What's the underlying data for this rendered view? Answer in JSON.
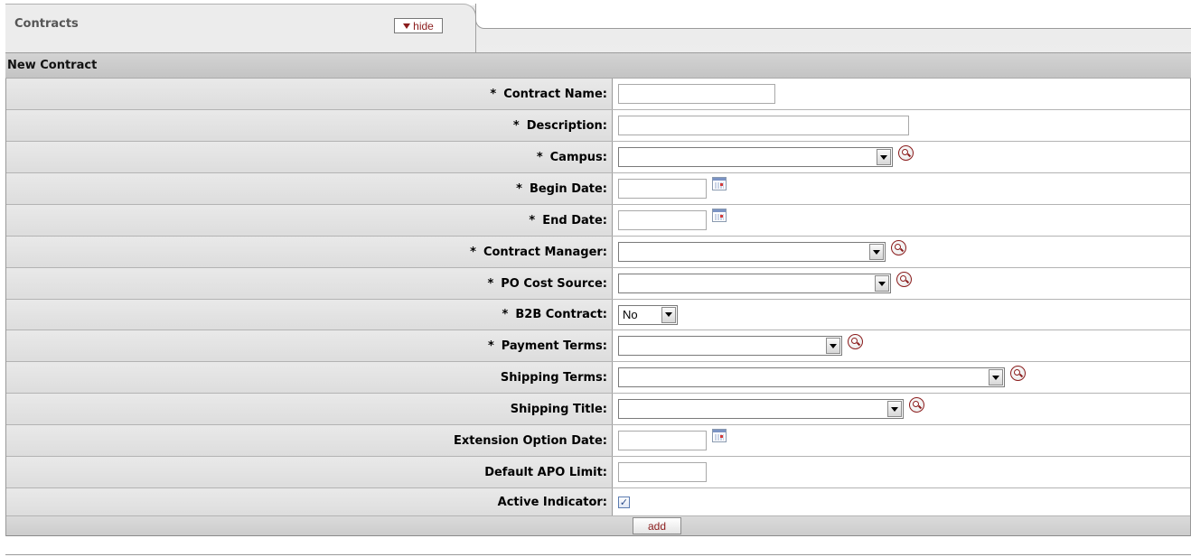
{
  "tab": {
    "title": "Contracts",
    "hide_label": "hide"
  },
  "section": {
    "title": "New Contract",
    "add_label": "add"
  },
  "fields": {
    "contract_name": {
      "label": "Contract Name:",
      "required": "*",
      "value": ""
    },
    "description": {
      "label": "Description:",
      "required": "*",
      "value": ""
    },
    "campus": {
      "label": "Campus:",
      "required": "*",
      "value": ""
    },
    "begin_date": {
      "label": "Begin Date:",
      "required": "*",
      "value": ""
    },
    "end_date": {
      "label": "End Date:",
      "required": "*",
      "value": ""
    },
    "contract_manager": {
      "label": "Contract Manager:",
      "required": "*",
      "value": ""
    },
    "po_cost_source": {
      "label": "PO Cost Source:",
      "required": "*",
      "value": ""
    },
    "b2b_contract": {
      "label": "B2B Contract:",
      "required": "*",
      "value": "No"
    },
    "payment_terms": {
      "label": "Payment Terms:",
      "required": "*",
      "value": ""
    },
    "shipping_terms": {
      "label": "Shipping Terms:",
      "value": ""
    },
    "shipping_title": {
      "label": "Shipping Title:",
      "value": ""
    },
    "extension_option_date": {
      "label": "Extension Option Date:",
      "value": ""
    },
    "default_apo_limit": {
      "label": "Default APO Limit:",
      "value": ""
    },
    "active_indicator": {
      "label": "Active Indicator:",
      "checked": true,
      "checkmark": "✓"
    }
  },
  "icons": {
    "lookup": "magnifier-lookup-icon",
    "calendar": "calendar-icon",
    "collapse": "triangle-down-icon"
  },
  "colors": {
    "accent": "#8b1c1c",
    "header_bg": "#c4c4c4",
    "label_bg": "#e3e3e3"
  }
}
